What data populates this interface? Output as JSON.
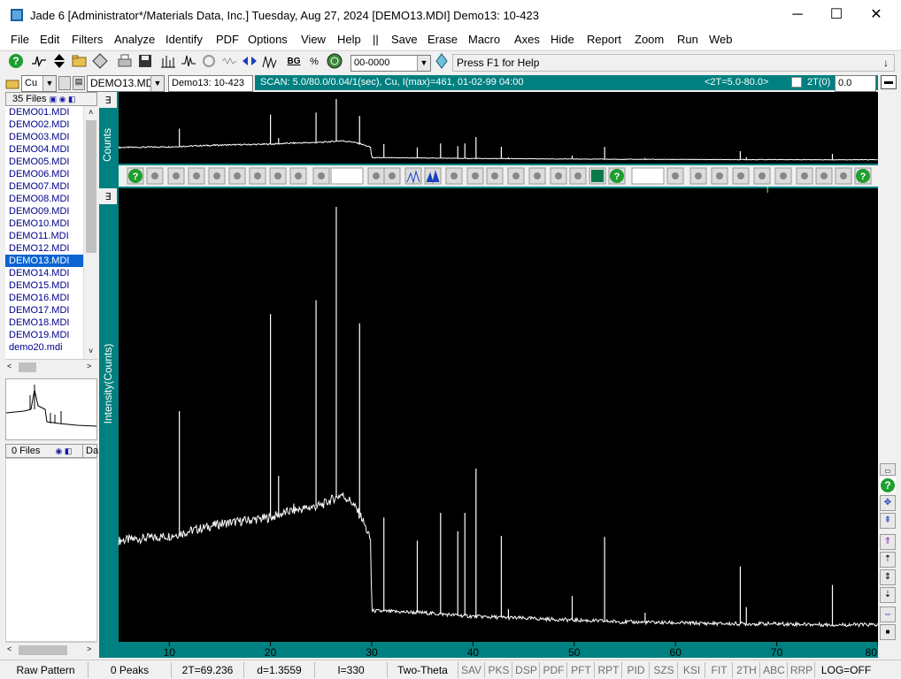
{
  "window": {
    "title": "Jade 6 [Administrator*/Materials Data, Inc.] Tuesday, Aug 27, 2024 [DEMO13.MDI] Demo13: 10-423",
    "minimize": "─",
    "maximize": "☐",
    "close": "✕"
  },
  "menu": [
    "File",
    "Edit",
    "Filters",
    "Analyze",
    "Identify",
    "PDF",
    "Options",
    "View",
    "Help",
    "||",
    "Save",
    "Erase",
    "Macro",
    "Axes",
    "Hide",
    "Report",
    "Zoom",
    "Run",
    "Web"
  ],
  "toolbar": {
    "pdf_combo": "00-0000",
    "hint": "Press F1 for Help",
    "hint_arrow": "↓"
  },
  "row2": {
    "anode": "Cu",
    "file_combo": "DEMO13.MDI",
    "pattern_id": "Demo13: 10-423",
    "scan": "SCAN: 5.0/80.0/0.04/1(sec), Cu, I(max)=461, 01-02-99 04:00",
    "range": "<2T=5.0-80.0>",
    "twotheta0_label": "2T(0)",
    "twotheta0_value": "0.0"
  },
  "left_panel": {
    "files_header": "35 Files",
    "files": [
      "DEMO01.MDI",
      "DEMO02.MDI",
      "DEMO03.MDI",
      "DEMO04.MDI",
      "DEMO05.MDI",
      "DEMO06.MDI",
      "DEMO07.MDI",
      "DEMO08.MDI",
      "DEMO09.MDI",
      "DEMO10.MDI",
      "DEMO11.MDI",
      "DEMO12.MDI",
      "DEMO13.MDI",
      "DEMO14.MDI",
      "DEMO15.MDI",
      "DEMO16.MDI",
      "DEMO17.MDI",
      "DEMO18.MDI",
      "DEMO19.MDI",
      "demo20.mdi"
    ],
    "selected_file": "DEMO13.MDI",
    "lower_header": "0 Files",
    "lower_tab": "Da"
  },
  "chart_data": [
    {
      "type": "line",
      "title": "",
      "ylabel": "Counts",
      "xlim": [
        5,
        80
      ],
      "note_panel": "overview"
    },
    {
      "type": "line",
      "ylabel": "Intensity(Counts)",
      "xlabel": "",
      "xlim": [
        5,
        80
      ],
      "x_ticks": [
        10,
        20,
        30,
        40,
        50,
        60,
        70,
        80
      ],
      "x_tick_labels": [
        "10",
        "20",
        "30",
        "40",
        "50",
        "60",
        "70",
        "80"
      ],
      "ylim": [
        0,
        461
      ],
      "background": [
        [
          5,
          100
        ],
        [
          10,
          105
        ],
        [
          15,
          118
        ],
        [
          20,
          125
        ],
        [
          22,
          132
        ],
        [
          25,
          138
        ],
        [
          27,
          150
        ],
        [
          28,
          142
        ],
        [
          29,
          125
        ],
        [
          29.9,
          100
        ],
        [
          30,
          24
        ],
        [
          35,
          22
        ],
        [
          40,
          18
        ],
        [
          45,
          16
        ],
        [
          50,
          14
        ],
        [
          55,
          12
        ],
        [
          60,
          11
        ],
        [
          65,
          10
        ],
        [
          70,
          10
        ],
        [
          75,
          9
        ],
        [
          80,
          9
        ]
      ],
      "peaks": [
        {
          "x": 11.0,
          "y": 240
        },
        {
          "x": 20.0,
          "y": 345
        },
        {
          "x": 20.8,
          "y": 170
        },
        {
          "x": 22.3,
          "y": 140
        },
        {
          "x": 24.5,
          "y": 360
        },
        {
          "x": 26.5,
          "y": 461
        },
        {
          "x": 28.8,
          "y": 335
        },
        {
          "x": 31.2,
          "y": 125
        },
        {
          "x": 34.5,
          "y": 100
        },
        {
          "x": 36.8,
          "y": 130
        },
        {
          "x": 38.5,
          "y": 110
        },
        {
          "x": 39.2,
          "y": 130
        },
        {
          "x": 40.3,
          "y": 178
        },
        {
          "x": 42.8,
          "y": 105
        },
        {
          "x": 43.5,
          "y": 26
        },
        {
          "x": 49.8,
          "y": 40
        },
        {
          "x": 53.0,
          "y": 104
        },
        {
          "x": 57.0,
          "y": 22
        },
        {
          "x": 66.4,
          "y": 72
        },
        {
          "x": 67.0,
          "y": 28
        },
        {
          "x": 75.5,
          "y": 52
        }
      ]
    }
  ],
  "status": {
    "mode": "Raw Pattern",
    "peaks": "0 Peaks",
    "twotheta": "2T=69.236",
    "dspacing": "d=1.3559",
    "intensity": "I=330",
    "axis": "Two-Theta",
    "cells": [
      "SAV",
      "PKS",
      "DSP",
      "PDF",
      "PFT",
      "RPT",
      "PID",
      "SZS",
      "KSI",
      "FIT",
      "2TH",
      "ABC",
      "RRP"
    ],
    "log": "LOG=OFF"
  },
  "icons": [
    "help-icon",
    "pattern-icon",
    "updown-icon",
    "open-folder-icon",
    "diamond-icon",
    "print-icon",
    "save-disk-icon",
    "bar-chart-icon",
    "fit-icon",
    "refresh-icon",
    "wave-icon",
    "arrows-icon",
    "peaks-icon",
    "bg-icon",
    "percent-icon",
    "globe-icon",
    "flag-icon"
  ]
}
